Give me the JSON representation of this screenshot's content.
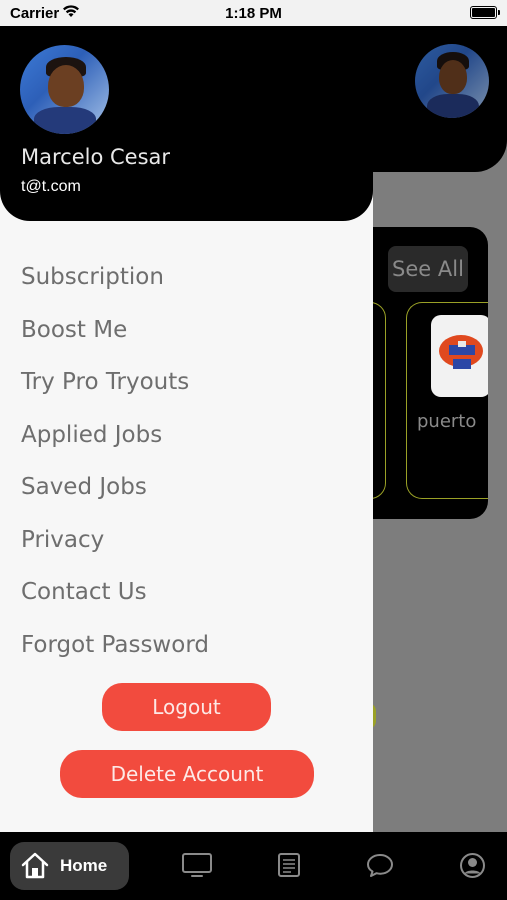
{
  "status_bar": {
    "carrier": "Carrier",
    "time": "1:18 PM"
  },
  "profile": {
    "name": "Marcelo Cesar",
    "email": "t@t.com"
  },
  "menu": [
    {
      "label": "Subscription"
    },
    {
      "label": "Boost Me"
    },
    {
      "label": "Try Pro Tryouts"
    },
    {
      "label": "Applied Jobs"
    },
    {
      "label": "Saved Jobs"
    },
    {
      "label": "Privacy"
    },
    {
      "label": "Contact Us"
    },
    {
      "label": "Forgot Password"
    }
  ],
  "buttons": {
    "logout": "Logout",
    "delete_account": "Delete Account"
  },
  "background": {
    "see_all": "See All",
    "card_label": "puerto"
  },
  "tab_bar": {
    "home_label": "Home",
    "tabs": [
      "home-icon",
      "tv-icon",
      "document-icon",
      "chat-icon",
      "profile-icon"
    ]
  },
  "colors": {
    "accent": "#f24b3e",
    "header": "#000000",
    "drawer_bg": "#f7f7f7",
    "menu_text": "#6e6e6e",
    "card_border": "#9aa126"
  }
}
